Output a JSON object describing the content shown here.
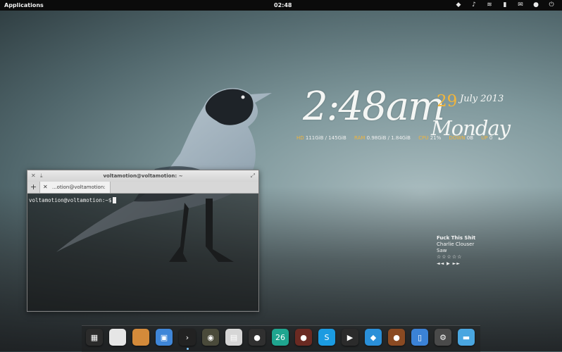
{
  "top_panel": {
    "applications_label": "Applications",
    "clock": "02:48",
    "tray_icons": [
      "dropbox-icon",
      "volume-icon",
      "wifi-icon",
      "battery-icon",
      "mail-icon",
      "user-icon",
      "power-icon"
    ]
  },
  "conky": {
    "time": "2:48am",
    "day": "29",
    "month_year": "July 2013",
    "weekday": "Monday",
    "stats": [
      {
        "label": "HD",
        "value": "111GiB / 145GiB"
      },
      {
        "label": "RAM",
        "value": "0.98GiB / 1.84GiB"
      },
      {
        "label": "CPU",
        "value": "21%"
      },
      {
        "label": "DOWN",
        "value": "0B"
      },
      {
        "label": "UP",
        "value": "0"
      }
    ],
    "accent_color": "#f2b53b"
  },
  "terminal": {
    "title": "voltamotion@voltamotion: ~",
    "tab_label": "...otion@voltamotion: ~",
    "new_tab_symbol": "+",
    "prompt": "voltamotion@voltamotion:~$"
  },
  "music": {
    "song": "Fuck This Shit",
    "artist": "Charlie Clouser",
    "album": "Saw",
    "rating": "☆☆☆☆☆",
    "controls": "◄◄ ▶ ►►"
  },
  "dock": {
    "items": [
      {
        "name": "calculator-icon",
        "glyph": "▦",
        "color": "#2b2b2b",
        "running": false
      },
      {
        "name": "files-icon",
        "glyph": "",
        "color": "#e6e6e6",
        "running": false
      },
      {
        "name": "wallpaper-icon",
        "glyph": "",
        "color": "#d48a3a",
        "running": false
      },
      {
        "name": "photos-icon",
        "glyph": "▣",
        "color": "#3f86d8",
        "running": false
      },
      {
        "name": "terminal-icon",
        "glyph": "›",
        "color": "#222222",
        "running": true
      },
      {
        "name": "camera-icon",
        "glyph": "◉",
        "color": "#4a4a3a",
        "running": false
      },
      {
        "name": "calendar-icon",
        "glyph": "▤",
        "color": "#d6d6d6",
        "running": false
      },
      {
        "name": "browser-icon",
        "glyph": "●",
        "color": "#303030",
        "running": false
      },
      {
        "name": "date-icon",
        "glyph": "26",
        "color": "#1fa58f",
        "running": false
      },
      {
        "name": "contacts-icon",
        "glyph": "●",
        "color": "#6a2a22",
        "running": false
      },
      {
        "name": "skype-icon",
        "glyph": "S",
        "color": "#1b9be1",
        "running": false
      },
      {
        "name": "youtube-icon",
        "glyph": "▶",
        "color": "#2b2b2b",
        "running": false
      },
      {
        "name": "dropbox-icon",
        "glyph": "◆",
        "color": "#2a8fd8",
        "running": false
      },
      {
        "name": "user-icon",
        "glyph": "●",
        "color": "#8a4a22",
        "running": false
      },
      {
        "name": "document-icon",
        "glyph": "▯",
        "color": "#3b82d6",
        "running": false
      },
      {
        "name": "settings-icon",
        "glyph": "⚙",
        "color": "#4a4a4a",
        "running": false
      },
      {
        "name": "workspace-icon",
        "glyph": "▬",
        "color": "#4aa6e0",
        "running": false
      }
    ]
  }
}
